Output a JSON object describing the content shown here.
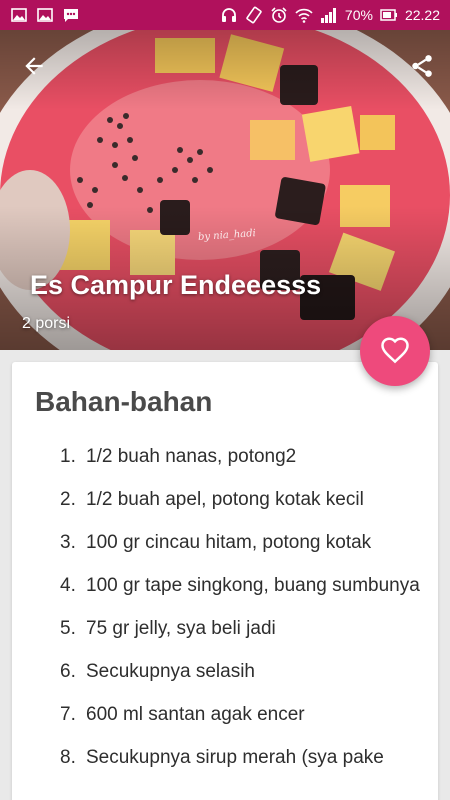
{
  "status_bar": {
    "left_icons": [
      "image-icon",
      "image-icon",
      "chat-icon"
    ],
    "right_icons": [
      "headphones-icon",
      "rotate-icon",
      "alarm-icon",
      "wifi-icon",
      "signal-icon"
    ],
    "battery_percent": "70%",
    "time": "22.22",
    "background": "#b0115c"
  },
  "hero": {
    "title": "Es Campur Endeeesss",
    "portion": "2 porsi",
    "watermark": "by nia_hadi",
    "back_icon": "arrow-back-icon",
    "share_icon": "share-icon"
  },
  "fab": {
    "icon": "heart-outline-icon",
    "color": "#ee4a7c"
  },
  "card": {
    "title": "Bahan-bahan",
    "ingredients": [
      {
        "num": "1.",
        "text": "1/2 buah nanas, potong2"
      },
      {
        "num": "2.",
        "text": "1/2 buah apel, potong kotak kecil"
      },
      {
        "num": "3.",
        "text": "100 gr cincau hitam, potong kotak"
      },
      {
        "num": "4.",
        "text": "100 gr tape singkong, buang sumbunya"
      },
      {
        "num": "5.",
        "text": "75 gr jelly, sya beli jadi"
      },
      {
        "num": "6.",
        "text": "Secukupnya selasih"
      },
      {
        "num": "7.",
        "text": "600 ml santan agak encer"
      },
      {
        "num": "8.",
        "text": "Secukupnya sirup merah (sya pake"
      }
    ]
  }
}
